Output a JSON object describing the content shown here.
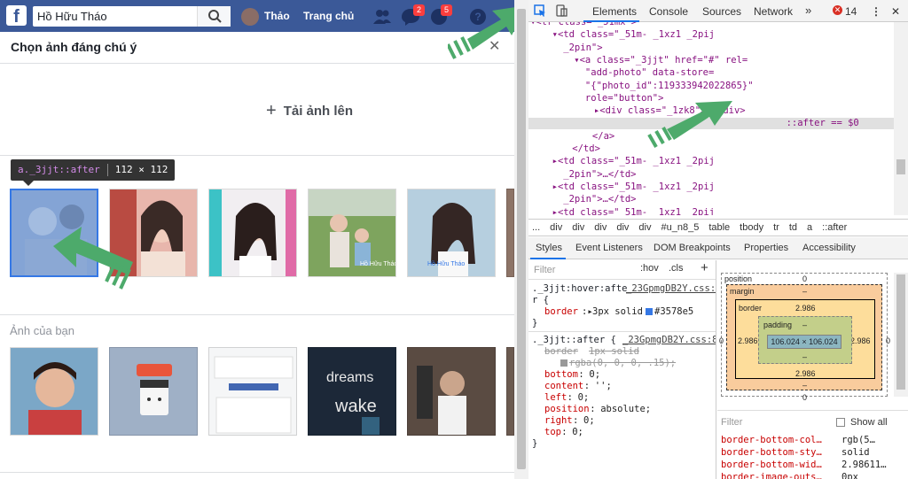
{
  "facebook": {
    "search_value": "Hồ Hữu Tháo",
    "profile_name": "Thảo",
    "home_label": "Trang chủ",
    "messages_badge": "2",
    "notifications_badge": "5",
    "brand_color": "#3b5998"
  },
  "dialog": {
    "title": "Chọn ảnh đáng chú ý",
    "upload_label": "Tải ảnh lên",
    "your_photos_label": "Ảnh của bạn"
  },
  "tooltip": {
    "selector": "a._3jjt::after",
    "size": "112 × 112"
  },
  "photos_row1": [
    {
      "name": "photo-1",
      "caption": "Hồ Hữu Tháo"
    },
    {
      "name": "photo-2",
      "caption": ""
    },
    {
      "name": "photo-3",
      "caption": ""
    },
    {
      "name": "photo-4",
      "caption": "Hồ Hữu Tháo"
    },
    {
      "name": "photo-5",
      "caption": "Hồ Hữu Tháo"
    }
  ],
  "devtools": {
    "tabs": [
      "Elements",
      "Console",
      "Sources",
      "Network"
    ],
    "more_tabs": "»",
    "error_count": "14",
    "dom_lines": [
      {
        "t": "▾<tr class=\"_51mx\">"
      },
      {
        "t": "  ▾<td class=\"_51m- _1xz1 _2pij"
      },
      {
        "t": "    _2pin\">"
      },
      {
        "t": "    ▾<a class=\"_3jjt\" href=\"#\" rel="
      },
      {
        "t": "      \"add-photo\" data-store="
      },
      {
        "t": "      \"{\"photo_id\":119333942022865}\""
      },
      {
        "t": "      role=\"button\">"
      },
      {
        "t": "      ▸<div class=\"_1zk8\">…</div>"
      },
      {
        "t": "        ::after == $0"
      },
      {
        "t": "      </a>"
      },
      {
        "t": "    </td>"
      },
      {
        "t": "  ▸<td class=\"_51m- _1xz1 _2pij"
      },
      {
        "t": "    _2pin\">…</td>"
      },
      {
        "t": "  ▸<td class=\"_51m- _1xz1 _2pij"
      },
      {
        "t": "    _2pin\">…</td>"
      },
      {
        "t": "  ▸<td class=\"_51m- _1xz1 _2pij"
      },
      {
        "t": "    _2pin\">…</td>"
      }
    ],
    "breadcrumbs": [
      "...",
      "div",
      "div",
      "div",
      "div",
      "div",
      "#u_n8_5",
      "table",
      "tbody",
      "tr",
      "td",
      "a",
      "::after"
    ],
    "subtabs": [
      "Styles",
      "Event Listeners",
      "DOM Breakpoints",
      "Properties",
      "Accessibility"
    ],
    "filter_placeholder": "Filter",
    "hov": ":hov",
    "cls": ".cls",
    "add": "+",
    "rules": {
      "hover_selector": "._3jjt:hover:afte",
      "hover_selector_tail": "r {",
      "hover_source": "_23GpmgDB2Y.css:8",
      "hover_prop": "border",
      "hover_val": "3px solid",
      "hover_color": "#3578e5",
      "after_selector": "._3jjt::after {",
      "after_source": "_23GpmgDB2Y.css:8",
      "struck_prop": "border",
      "struck_val": "1px solid",
      "struck_val2": "rgba(0, 0, 0, .15);",
      "props": [
        {
          "p": "bottom",
          "v": "0;"
        },
        {
          "p": "content",
          "v": "'';"
        },
        {
          "p": "left",
          "v": "0;"
        },
        {
          "p": "position",
          "v": "absolute;"
        },
        {
          "p": "right",
          "v": "0;"
        },
        {
          "p": "top",
          "v": "0;"
        }
      ]
    },
    "box_model": {
      "position_label": "position",
      "position_top": "0",
      "margin_label": "margin",
      "margin_dash": "–",
      "border_label": "border",
      "border_val": "2.986",
      "padding_label": "padding",
      "padding_dash": "–",
      "content_size": "106.024 × 106.024",
      "side_zero": "0"
    },
    "computed": {
      "filter": "Filter",
      "show_all": "Show all",
      "rows": [
        {
          "p": "border-bottom-col…",
          "v": "rgb(5…"
        },
        {
          "p": "border-bottom-sty…",
          "v": "solid"
        },
        {
          "p": "border-bottom-wid…",
          "v": "2.98611…"
        },
        {
          "p": "border-image-outs…",
          "v": "0px"
        }
      ]
    }
  }
}
